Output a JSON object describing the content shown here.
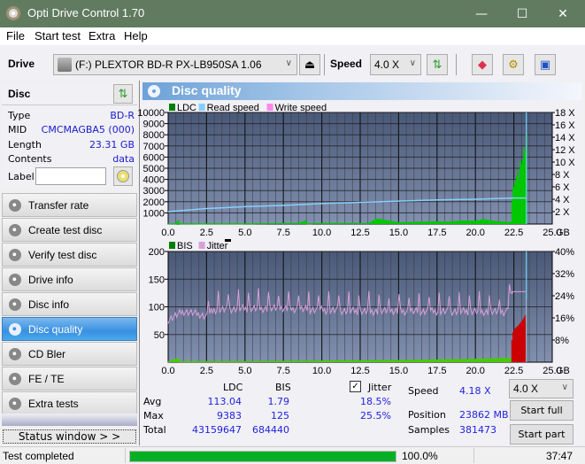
{
  "window": {
    "title": "Opti Drive Control 1.70",
    "minimize": "—",
    "maximize": "☐",
    "close": "✕"
  },
  "menu": [
    "File",
    "Start test",
    "Extra",
    "Help"
  ],
  "toolbar": {
    "drive_label": "Drive",
    "drive_value": "(F:)  PLEXTOR BD-R  PX-LB950SA 1.06",
    "speed_label": "Speed",
    "speed_value": "4.0 X",
    "icons": [
      "eject-icon",
      "refresh-icon",
      "eraser-icon",
      "gear-icon",
      "save-icon"
    ]
  },
  "disc": {
    "header": "Disc",
    "fields": [
      {
        "key": "Type",
        "value": "BD-R"
      },
      {
        "key": "MID",
        "value": "CMCMAGBA5 (000)"
      },
      {
        "key": "Length",
        "value": "23.31 GB"
      },
      {
        "key": "Contents",
        "value": "data"
      }
    ],
    "label_key": "Label",
    "label_value": ""
  },
  "nav": [
    {
      "label": "Transfer rate",
      "active": false
    },
    {
      "label": "Create test disc",
      "active": false
    },
    {
      "label": "Verify test disc",
      "active": false
    },
    {
      "label": "Drive info",
      "active": false
    },
    {
      "label": "Disc info",
      "active": false
    },
    {
      "label": "Disc quality",
      "active": true
    },
    {
      "label": "CD Bler",
      "active": false
    },
    {
      "label": "FE / TE",
      "active": false
    },
    {
      "label": "Extra tests",
      "active": false
    }
  ],
  "status_window_button": "Status window > >",
  "panel": {
    "title": "Disc quality"
  },
  "chart_data": [
    {
      "type": "area",
      "title": "LDC / Read speed",
      "legend": [
        {
          "name": "LDC",
          "color": "#008000"
        },
        {
          "name": "Read speed",
          "color": "#87cefa"
        },
        {
          "name": "Write speed",
          "color": "#ff88ee"
        }
      ],
      "xlabel": "GB",
      "xlim": [
        0,
        25
      ],
      "x_ticks": [
        "0.0",
        "2.5",
        "5.0",
        "7.5",
        "10.0",
        "12.5",
        "15.0",
        "17.5",
        "20.0",
        "22.5",
        "25.0"
      ],
      "ylim_left": [
        0,
        10000
      ],
      "y_ticks_left": [
        "1000",
        "2000",
        "3000",
        "4000",
        "5000",
        "6000",
        "7000",
        "8000",
        "9000",
        "10000"
      ],
      "ylim_right": [
        0,
        18
      ],
      "y_ticks_right": [
        "2 X",
        "4 X",
        "6 X",
        "8 X",
        "10 X",
        "12 X",
        "14 X",
        "16 X",
        "18 X"
      ],
      "series": [
        {
          "name": "LDC",
          "x": [
            0.0,
            0.5,
            0.6,
            0.7,
            2.0,
            5.0,
            8.5,
            8.9,
            9.0,
            10.0,
            13.0,
            13.5,
            15.0,
            17.5,
            18.0,
            19.0,
            20.0,
            20.5,
            21.0,
            21.5,
            22.0,
            22.3,
            22.35,
            22.5,
            22.6,
            22.7,
            22.8,
            22.9,
            23.0,
            23.1,
            23.2,
            23.3,
            23.35
          ],
          "values": [
            50,
            60,
            450,
            60,
            50,
            60,
            100,
            350,
            60,
            100,
            80,
            500,
            150,
            250,
            200,
            300,
            300,
            450,
            300,
            250,
            200,
            200,
            2800,
            4000,
            3400,
            5200,
            4000,
            6000,
            5000,
            7000,
            6500,
            8800,
            9383
          ]
        },
        {
          "name": "Read speed",
          "x": [
            0.0,
            1.0,
            2.5,
            5.0,
            7.5,
            10.0,
            12.5,
            15.0,
            17.5,
            20.0,
            22.5,
            23.31
          ],
          "values": [
            2.0,
            2.2,
            2.5,
            2.8,
            3.0,
            3.3,
            3.5,
            3.7,
            3.9,
            4.0,
            4.2,
            4.2
          ]
        }
      ]
    },
    {
      "type": "area",
      "title": "BIS / Jitter",
      "legend": [
        {
          "name": "BIS",
          "color": "#008000"
        },
        {
          "name": "Jitter",
          "color": "#d8a0d8"
        }
      ],
      "xlabel": "GB",
      "xlim": [
        0,
        25
      ],
      "x_ticks": [
        "0.0",
        "2.5",
        "5.0",
        "7.5",
        "10.0",
        "12.5",
        "15.0",
        "17.5",
        "20.0",
        "22.5",
        "25.0"
      ],
      "ylim_left": [
        0,
        200
      ],
      "y_ticks_left": [
        "50",
        "100",
        "150",
        "200"
      ],
      "ylim_right": [
        0,
        40
      ],
      "y_ticks_right": [
        "8%",
        "16%",
        "24%",
        "32%",
        "40%"
      ],
      "series": [
        {
          "name": "BIS",
          "x": [
            0.0,
            0.6,
            0.7,
            5.0,
            10.0,
            15.0,
            20.0,
            22.3,
            22.35,
            22.5,
            22.7,
            23.0,
            23.2,
            23.3
          ],
          "values": [
            2,
            8,
            2,
            2,
            3,
            4,
            6,
            8,
            50,
            60,
            65,
            75,
            85,
            125
          ]
        },
        {
          "name": "Jitter",
          "x": [
            0.0,
            1.0,
            2.0,
            2.5,
            3.0,
            5.0,
            7.5,
            10.0,
            12.5,
            15.0,
            17.5,
            20.0,
            22.0,
            22.4,
            23.3
          ],
          "values": [
            15.5,
            18.5,
            17.5,
            16.5,
            19.0,
            19.5,
            19.5,
            19.0,
            18.5,
            18.5,
            18.5,
            18.5,
            18.0,
            25.5,
            25.5
          ]
        }
      ]
    }
  ],
  "stats": {
    "col_ldc": "LDC",
    "col_bis": "BIS",
    "jitter_label": "Jitter",
    "jitter_checked": true,
    "rows": [
      {
        "label": "Avg",
        "ldc": "113.04",
        "bis": "1.79",
        "jitter": "18.5%"
      },
      {
        "label": "Max",
        "ldc": "9383",
        "bis": "125",
        "jitter": "25.5%"
      },
      {
        "label": "Total",
        "ldc": "43159647",
        "bis": "684440",
        "jitter": ""
      }
    ],
    "speed_label": "Speed",
    "speed_value": "4.18 X",
    "position_label": "Position",
    "position_value": "23862 MB",
    "samples_label": "Samples",
    "samples_value": "381473",
    "speed_select": "4.0 X",
    "start_full": "Start full",
    "start_part": "Start part"
  },
  "statusbar": {
    "text": "Test completed",
    "progress_percent": 100,
    "progress_text": "100.0%",
    "time": "37:47"
  }
}
